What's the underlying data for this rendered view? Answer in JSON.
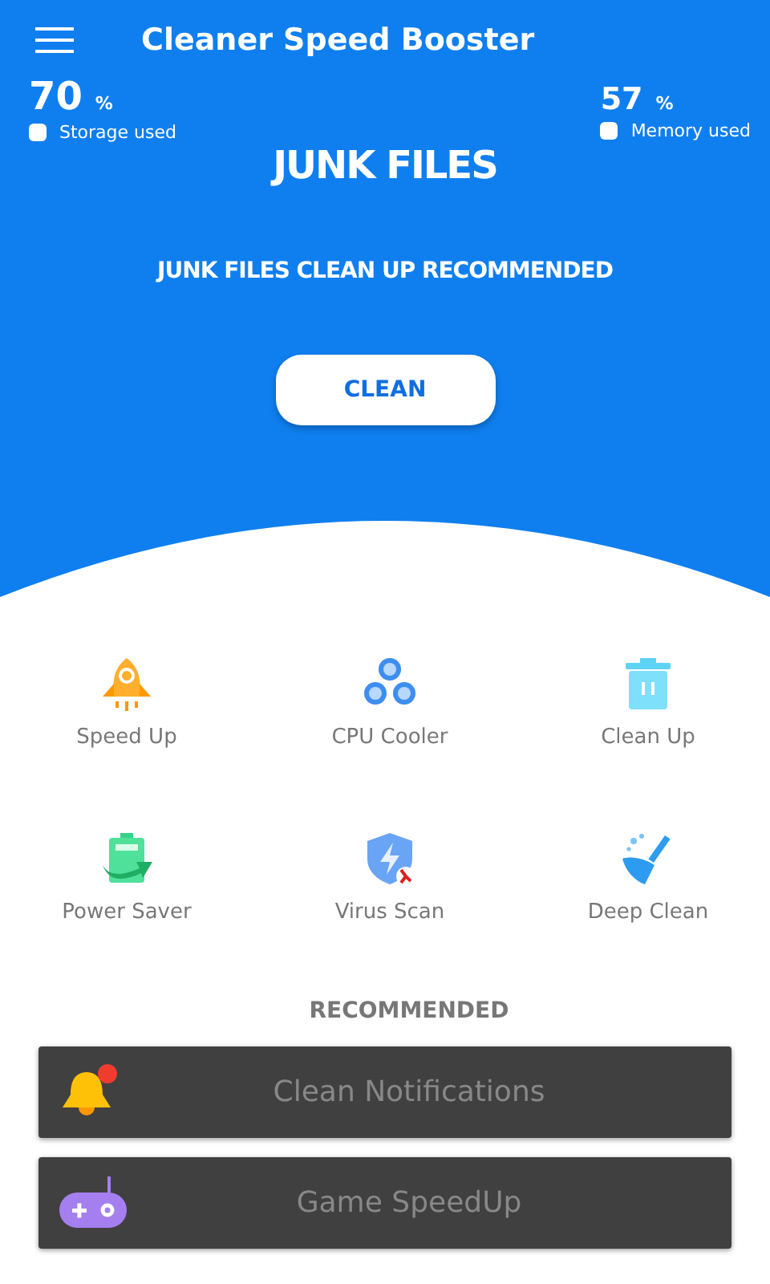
{
  "app_bar": {
    "title": "Cleaner Speed Booster"
  },
  "stats": [
    {
      "value": "70",
      "unit": "%",
      "label": "Storage used"
    },
    {
      "value": "57",
      "unit": "%",
      "label": "Memory used"
    }
  ],
  "banner": {
    "title": "JUNK FILES",
    "subtitle": "JUNK FILES CLEAN UP RECOMMENDED",
    "button": "CLEAN"
  },
  "tools": [
    {
      "label": "Speed Up"
    },
    {
      "label": "CPU Cooler"
    },
    {
      "label": "Clean Up"
    },
    {
      "label": "Power Saver"
    },
    {
      "label": "Virus Scan"
    },
    {
      "label": "Deep Clean"
    }
  ],
  "recommended": {
    "heading": "RECOMMENDED",
    "items": [
      {
        "label": "Clean Notifications"
      },
      {
        "label": "Game SpeedUp"
      }
    ]
  }
}
